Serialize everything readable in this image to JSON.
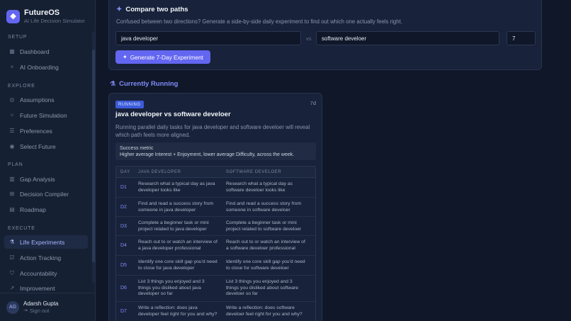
{
  "app": {
    "name": "FutureOS",
    "subtitle": "AI Life Decision Simulator",
    "logo_glyph": "❖",
    "accent": "#6366f1"
  },
  "sidebar": {
    "sections": [
      {
        "label": "SETUP",
        "items": [
          {
            "label": "Dashboard",
            "icon": "grid-icon",
            "glyph": "▦"
          },
          {
            "label": "AI Onboarding",
            "icon": "sparkle-icon",
            "glyph": "✧"
          }
        ]
      },
      {
        "label": "EXPLORE",
        "items": [
          {
            "label": "Assumptions",
            "icon": "target-icon",
            "glyph": "◎"
          },
          {
            "label": "Future Simulation",
            "icon": "branch-icon",
            "glyph": "⑂"
          },
          {
            "label": "Preferences",
            "icon": "sliders-icon",
            "glyph": "☰"
          },
          {
            "label": "Select Future",
            "icon": "compass-icon",
            "glyph": "◉"
          }
        ]
      },
      {
        "label": "PLAN",
        "items": [
          {
            "label": "Gap Analysis",
            "icon": "chart-icon",
            "glyph": "▥"
          },
          {
            "label": "Decision Compiler",
            "icon": "cpu-icon",
            "glyph": "⊞"
          },
          {
            "label": "Roadmap",
            "icon": "map-icon",
            "glyph": "▤"
          }
        ]
      },
      {
        "label": "EXECUTE",
        "items": [
          {
            "label": "Life Experiments",
            "icon": "flask-icon",
            "glyph": "⚗",
            "active": true
          },
          {
            "label": "Action Tracking",
            "icon": "check-list-icon",
            "glyph": "☑"
          },
          {
            "label": "Accountability",
            "icon": "shield-icon",
            "glyph": "⛉"
          },
          {
            "label": "Improvement",
            "icon": "trend-up-icon",
            "glyph": "↗"
          }
        ]
      }
    ]
  },
  "user": {
    "initials": "AG",
    "name": "Adarsh Gupta",
    "signout": "Sign out",
    "signout_glyph": "⇥"
  },
  "compare": {
    "title": "Compare two paths",
    "title_glyph": "✦",
    "description": "Confused between two directions? Generate a side-by-side daily experiment to find out which one actually feels right.",
    "path_a": "java developer",
    "vs": "vs",
    "path_b": "software develoer",
    "days": "7",
    "button": "Generate 7-Day Experiment",
    "button_glyph": "✦"
  },
  "running": {
    "heading": "Currently Running",
    "heading_glyph": "⚗",
    "badge": "RUNNING",
    "duration": "7d",
    "title": "java developer vs software develoer",
    "description": "Running parallel daily tasks for java developer and software develoer will reveal which path feels more aligned.",
    "metric_label": "Success metric",
    "metric_text": "Higher average Interest + Enjoyment, lower average Difficulty, across the week.",
    "columns": [
      "DAY",
      "JAVA DEVELOPER",
      "SOFTWARE DEVELOER"
    ],
    "rows": [
      {
        "day": "D1",
        "a": "Research what a typical day as java developer looks like",
        "b": "Research what a typical day as software develoer looks like"
      },
      {
        "day": "D2",
        "a": "Find and read a success story from someone in java developer",
        "b": "Find and read a success story from someone in software develoer"
      },
      {
        "day": "D3",
        "a": "Complete a beginner task or mini project related to java developer",
        "b": "Complete a beginner task or mini project related to software develoer"
      },
      {
        "day": "D4",
        "a": "Reach out to or watch an interview of a java developer professional",
        "b": "Reach out to or watch an interview of a software develoer professional"
      },
      {
        "day": "D5",
        "a": "Identify one core skill gap you'd need to close for java developer",
        "b": "Identify one core skill gap you'd need to close for software develoer"
      },
      {
        "day": "D6",
        "a": "List 3 things you enjoyed and 3 things you disliked about java developer so far",
        "b": "List 3 things you enjoyed and 3 things you disliked about software develoer so far"
      },
      {
        "day": "D7",
        "a": "Write a reflection: does java developer feel right for you and why?",
        "b": "Write a reflection: does software develoer feel right for you and why?"
      }
    ]
  }
}
